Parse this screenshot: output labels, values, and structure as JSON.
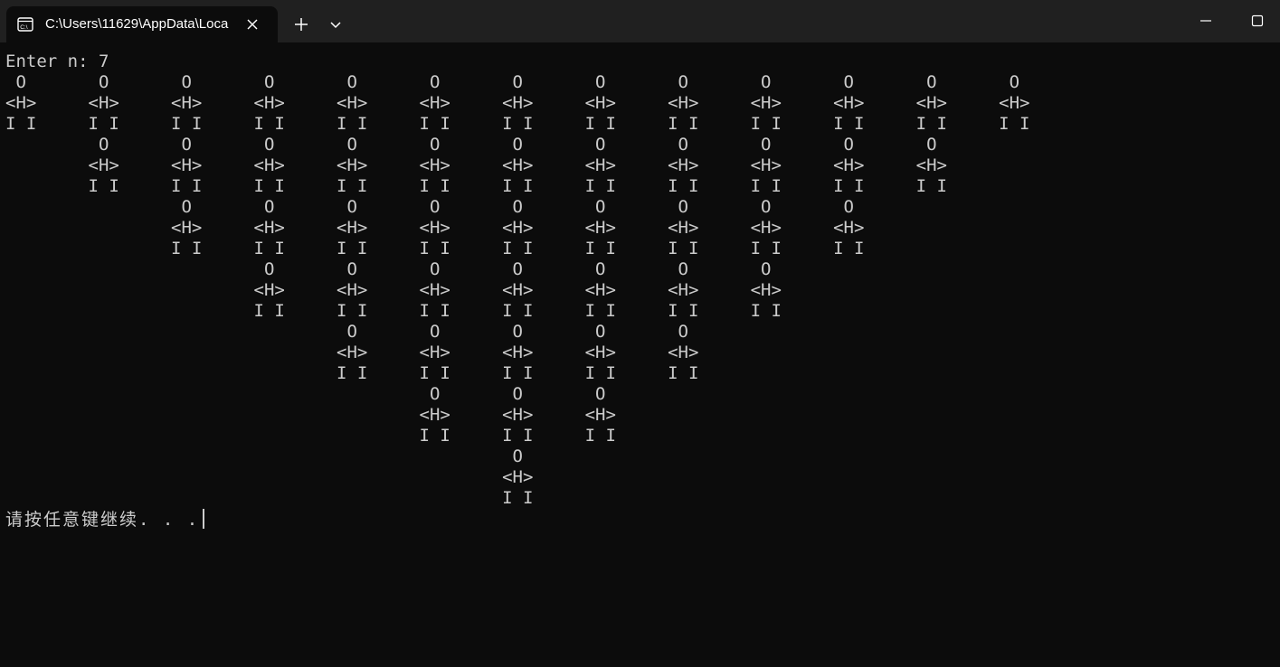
{
  "window": {
    "tab_title": "C:\\Users\\11629\\AppData\\Loca",
    "tab_icon": "terminal-icon",
    "close_tab_icon": "close-icon",
    "new_tab_icon": "plus-icon",
    "dropdown_icon": "chevron-down-icon",
    "minimize_icon": "minimize-icon",
    "maximize_icon": "maximize-icon"
  },
  "console": {
    "prompt": "Enter n: 7",
    "output_lines": [
      " O       O       O       O       O       O       O       O       O       O       O       O       O",
      "<H>     <H>     <H>     <H>     <H>     <H>     <H>     <H>     <H>     <H>     <H>     <H>     <H>",
      "I I     I I     I I     I I     I I     I I     I I     I I     I I     I I     I I     I I     I I",
      "         O       O       O       O       O       O       O       O       O       O       O",
      "        <H>     <H>     <H>     <H>     <H>     <H>     <H>     <H>     <H>     <H>     <H>",
      "        I I     I I     I I     I I     I I     I I     I I     I I     I I     I I     I I",
      "                 O       O       O       O       O       O       O       O       O",
      "                <H>     <H>     <H>     <H>     <H>     <H>     <H>     <H>     <H>",
      "                I I     I I     I I     I I     I I     I I     I I     I I     I I",
      "                         O       O       O       O       O       O       O",
      "                        <H>     <H>     <H>     <H>     <H>     <H>     <H>",
      "                        I I     I I     I I     I I     I I     I I     I I",
      "                                 O       O       O       O       O",
      "                                <H>     <H>     <H>     <H>     <H>",
      "                                I I     I I     I I     I I     I I",
      "                                         O       O       O",
      "                                        <H>     <H>     <H>",
      "                                        I I     I I     I I",
      "                                                 O",
      "                                                <H>",
      "                                                I I"
    ],
    "pause_message": "请按任意键继续. . ."
  },
  "colors": {
    "titlebar_bg": "#202020",
    "console_bg": "#0c0c0c",
    "text": "#cccccc"
  }
}
